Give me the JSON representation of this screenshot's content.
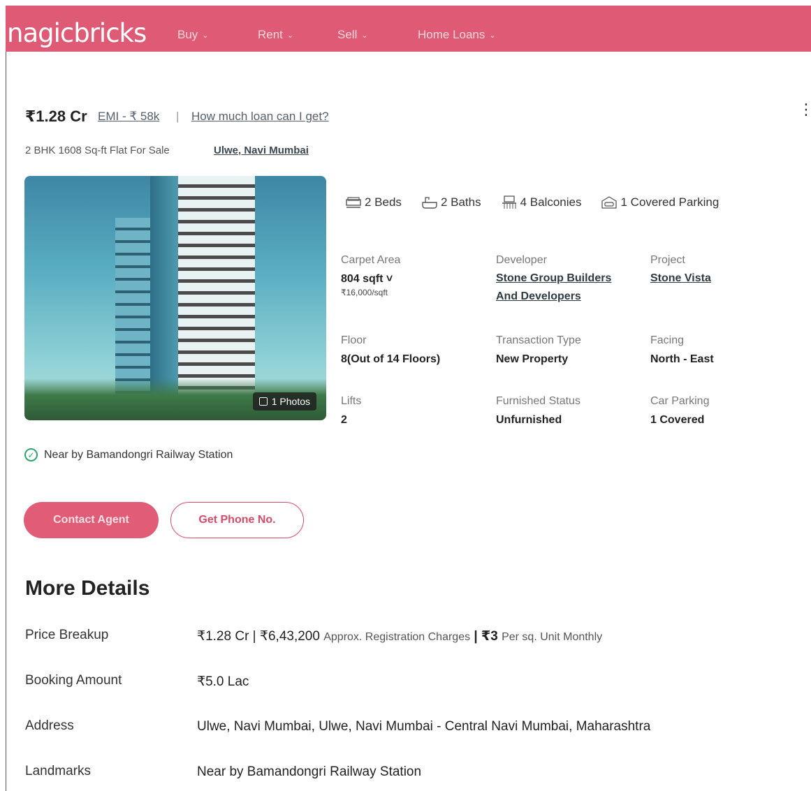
{
  "header": {
    "logo": "nagicbricks",
    "nav": [
      {
        "label": "Buy"
      },
      {
        "label": "Rent"
      },
      {
        "label": "Sell"
      },
      {
        "label": "Home Loans"
      }
    ]
  },
  "listing": {
    "price": "₹1.28 Cr",
    "emi": "EMI - ₹ 58k",
    "separator": "|",
    "loan_link": "How much loan can I get?",
    "subtitle": "2 BHK 1608 Sq-ft Flat For Sale",
    "locality": "Ulwe, Navi Mumbai",
    "photo_badge": "1 Photos",
    "amenities": {
      "beds": "2 Beds",
      "baths": "2 Baths",
      "balconies": "4 Balconies",
      "parking": "1 Covered Parking"
    },
    "specs": {
      "carpet_area": {
        "label": "Carpet Area",
        "value": "804 sqft ˅",
        "sub": "₹16,000/sqft"
      },
      "developer": {
        "label": "Developer",
        "value_line1": "Stone Group Builders",
        "value_line2": "And Developers"
      },
      "project": {
        "label": "Project",
        "value": "Stone Vista"
      },
      "floor": {
        "label": "Floor",
        "value": "8(Out of 14 Floors)"
      },
      "transaction": {
        "label": "Transaction Type",
        "value": "New Property"
      },
      "facing": {
        "label": "Facing",
        "value": "North - East"
      },
      "lifts": {
        "label": "Lifts",
        "value": "2"
      },
      "furnished": {
        "label": "Furnished Status",
        "value": "Unfurnished"
      },
      "car_parking": {
        "label": "Car Parking",
        "value": "1 Covered"
      }
    },
    "nearby": "Near by Bamandongri Railway Station",
    "contact_button": "Contact Agent",
    "phone_button": "Get Phone No."
  },
  "more_details": {
    "title": "More Details",
    "price_breakup": {
      "label": "Price Breakup",
      "price": "₹1.28 Cr | ₹6,43,200",
      "reg_note": "Approx. Registration Charges",
      "sep": "|",
      "maint": "₹3",
      "maint_note": "Per sq. Unit Monthly"
    },
    "booking": {
      "label": "Booking Amount",
      "value": "₹5.0 Lac"
    },
    "address": {
      "label": "Address",
      "value": "Ulwe, Navi Mumbai, Ulwe, Navi Mumbai - Central Navi Mumbai, Maharashtra"
    },
    "landmarks": {
      "label": "Landmarks",
      "value": "Near by Bamandongri Railway Station"
    }
  },
  "colors": {
    "brand": "#df5b75",
    "accent_button": "#e15c76",
    "check_green": "#2ea56a"
  },
  "icons": [
    "chevron-down-icon",
    "kebab-menu-icon",
    "bed-icon",
    "bath-icon",
    "balcony-icon",
    "parking-icon",
    "photo-icon",
    "check-circle-icon"
  ]
}
